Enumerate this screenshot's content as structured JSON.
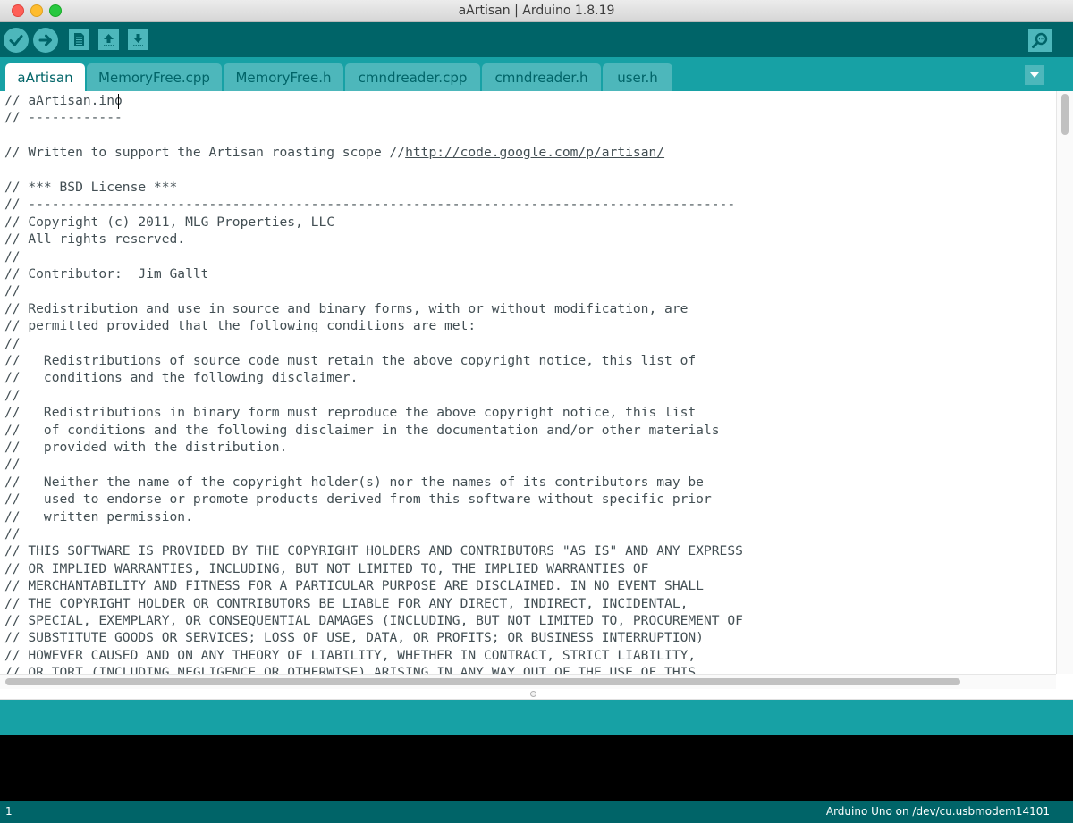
{
  "window": {
    "title": "aArtisan | Arduino 1.8.19"
  },
  "toolbar": {
    "buttons": [
      {
        "name": "verify",
        "icon": "checkmark-icon"
      },
      {
        "name": "upload",
        "icon": "right-arrow-icon"
      },
      {
        "name": "new",
        "icon": "page-icon"
      },
      {
        "name": "open",
        "icon": "up-arrow-icon"
      },
      {
        "name": "save",
        "icon": "down-arrow-icon"
      },
      {
        "name": "serial-monitor",
        "icon": "magnifier-icon"
      }
    ]
  },
  "tabs": [
    {
      "label": "aArtisan",
      "active": true
    },
    {
      "label": "MemoryFree.cpp",
      "active": false
    },
    {
      "label": "MemoryFree.h",
      "active": false
    },
    {
      "label": "cmndreader.cpp",
      "active": false
    },
    {
      "label": "cmndreader.h",
      "active": false
    },
    {
      "label": "user.h",
      "active": false
    }
  ],
  "editor": {
    "lines": [
      "// aArtisan.ino",
      "// ------------",
      "",
      "// Written to support the Artisan roasting scope //",
      "",
      "// *** BSD License ***",
      "// ------------------------------------------------------------------------------------------",
      "// Copyright (c) 2011, MLG Properties, LLC",
      "// All rights reserved.",
      "//",
      "// Contributor:  Jim Gallt",
      "//",
      "// Redistribution and use in source and binary forms, with or without modification, are",
      "// permitted provided that the following conditions are met:",
      "//",
      "//   Redistributions of source code must retain the above copyright notice, this list of",
      "//   conditions and the following disclaimer.",
      "//",
      "//   Redistributions in binary form must reproduce the above copyright notice, this list",
      "//   of conditions and the following disclaimer in the documentation and/or other materials",
      "//   provided with the distribution.",
      "//",
      "//   Neither the name of the copyright holder(s) nor the names of its contributors may be",
      "//   used to endorse or promote products derived from this software without specific prior",
      "//   written permission.",
      "//",
      "// THIS SOFTWARE IS PROVIDED BY THE COPYRIGHT HOLDERS AND CONTRIBUTORS \"AS IS\" AND ANY EXPRESS",
      "// OR IMPLIED WARRANTIES, INCLUDING, BUT NOT LIMITED TO, THE IMPLIED WARRANTIES OF",
      "// MERCHANTABILITY AND FITNESS FOR A PARTICULAR PURPOSE ARE DISCLAIMED. IN NO EVENT SHALL",
      "// THE COPYRIGHT HOLDER OR CONTRIBUTORS BE LIABLE FOR ANY DIRECT, INDIRECT, INCIDENTAL,",
      "// SPECIAL, EXEMPLARY, OR CONSEQUENTIAL DAMAGES (INCLUDING, BUT NOT LIMITED TO, PROCUREMENT OF",
      "// SUBSTITUTE GOODS OR SERVICES; LOSS OF USE, DATA, OR PROFITS; OR BUSINESS INTERRUPTION)",
      "// HOWEVER CAUSED AND ON ANY THEORY OF LIABILITY, WHETHER IN CONTRACT, STRICT LIABILITY,",
      "// OR TORT (INCLUDING NEGLIGENCE OR OTHERWISE) ARISING IN ANY WAY OUT OF THE USE OF THIS"
    ],
    "link_text": "http://code.google.com/p/artisan/"
  },
  "status": {
    "line_number": "1",
    "board": "Arduino Uno on /dev/cu.usbmodem14101"
  },
  "colors": {
    "toolbar": "#006468",
    "tabs_bar": "#17a1a5",
    "button": "#4db7bb",
    "console": "#000000"
  }
}
